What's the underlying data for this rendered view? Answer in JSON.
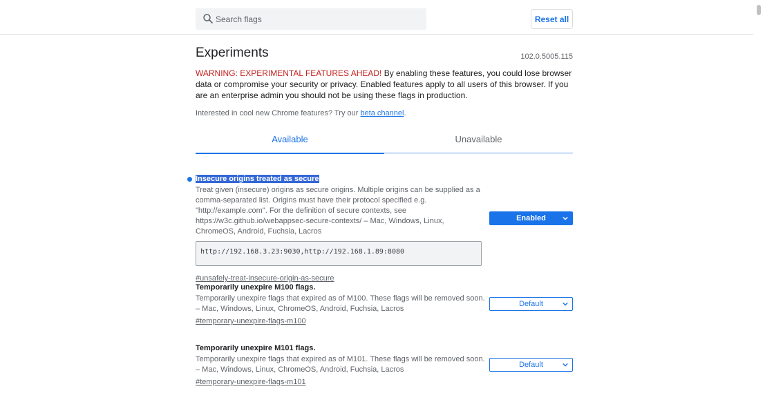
{
  "search": {
    "placeholder": "Search flags"
  },
  "toolbar": {
    "reset_label": "Reset all"
  },
  "page": {
    "title": "Experiments",
    "version": "102.0.5005.115",
    "warning_title": "WARNING: EXPERIMENTAL FEATURES AHEAD!",
    "warning_body": " By enabling these features, you could lose browser data or compromise your security or privacy. Enabled features apply to all users of this browser. If you are an enterprise admin you should not be using these flags in production.",
    "interest_text": "Interested in cool new Chrome features? Try our ",
    "interest_link": "beta channel",
    "interest_end": "."
  },
  "tabs": [
    {
      "label": "Available"
    },
    {
      "label": "Unavailable"
    }
  ],
  "experiments": [
    {
      "title": "Insecure origins treated as secure",
      "description": "Treat given (insecure) origins as secure origins. Multiple origins can be supplied as a comma-separated list. Origins must have their protocol specified e.g. \"http://example.com\". For the definition of secure contexts, see https://w3c.github.io/webappsec-secure-contexts/ – Mac, Windows, Linux, ChromeOS, Android, Fuchsia, Lacros",
      "textarea_value": "http://192.168.3.23:9030,http://192.168.1.89:8080",
      "link": "#unsafely-treat-insecure-origin-as-secure",
      "state": "Enabled"
    },
    {
      "title": "Temporarily unexpire M100 flags.",
      "description": "Temporarily unexpire flags that expired as of M100. These flags will be removed soon. – Mac, Windows, Linux, ChromeOS, Android, Fuchsia, Lacros",
      "link": "#temporary-unexpire-flags-m100",
      "state": "Default"
    },
    {
      "title": "Temporarily unexpire M101 flags.",
      "description": "Temporarily unexpire flags that expired as of M101. These flags will be removed soon. – Mac, Windows, Linux, ChromeOS, Android, Fuchsia, Lacros",
      "link": "#temporary-unexpire-flags-m101",
      "state": "Default"
    }
  ],
  "colors": {
    "accent": "#1a73e8",
    "warning": "#c5221f",
    "highlight": "#3367d6"
  },
  "icons": {
    "search": "search-icon",
    "select_chevron": "chevron-down-icon",
    "modified_indicator": "dot-icon"
  }
}
